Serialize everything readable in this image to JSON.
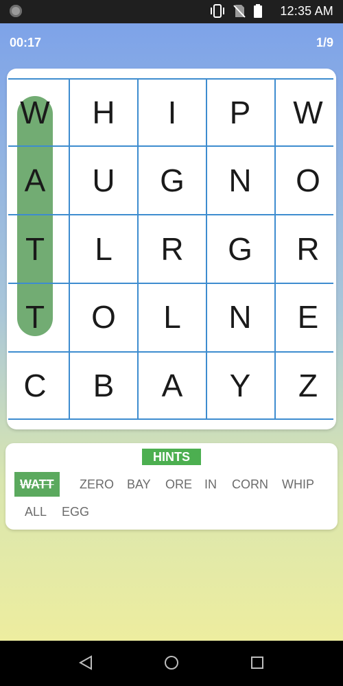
{
  "status_bar": {
    "time": "12:35 AM",
    "icons": [
      "vibrate-icon",
      "no-sim-icon",
      "battery-icon"
    ]
  },
  "header": {
    "timer": "00:17",
    "progress": "1/9"
  },
  "grid": {
    "rows": [
      [
        "W",
        "H",
        "I",
        "P",
        "W"
      ],
      [
        "A",
        "U",
        "G",
        "N",
        "O"
      ],
      [
        "T",
        "L",
        "R",
        "G",
        "R"
      ],
      [
        "T",
        "O",
        "L",
        "N",
        "E"
      ],
      [
        "C",
        "B",
        "A",
        "Y",
        "Z"
      ]
    ],
    "highlight_color": "#6aa86c",
    "line_color": "#3d8ccf"
  },
  "hints": {
    "title": "HINTS",
    "words": [
      {
        "text": "WATT",
        "found": true
      },
      {
        "text": "ZERO",
        "found": false
      },
      {
        "text": "BAY",
        "found": false
      },
      {
        "text": "ORE",
        "found": false
      },
      {
        "text": "IN",
        "found": false
      },
      {
        "text": "CORN",
        "found": false
      },
      {
        "text": "WHIP",
        "found": false
      },
      {
        "text": "ALL",
        "found": false
      },
      {
        "text": "EGG",
        "found": false
      }
    ],
    "accent_color": "#4caf50"
  },
  "nav": {
    "buttons": [
      "back-icon",
      "home-icon",
      "recents-icon"
    ]
  }
}
